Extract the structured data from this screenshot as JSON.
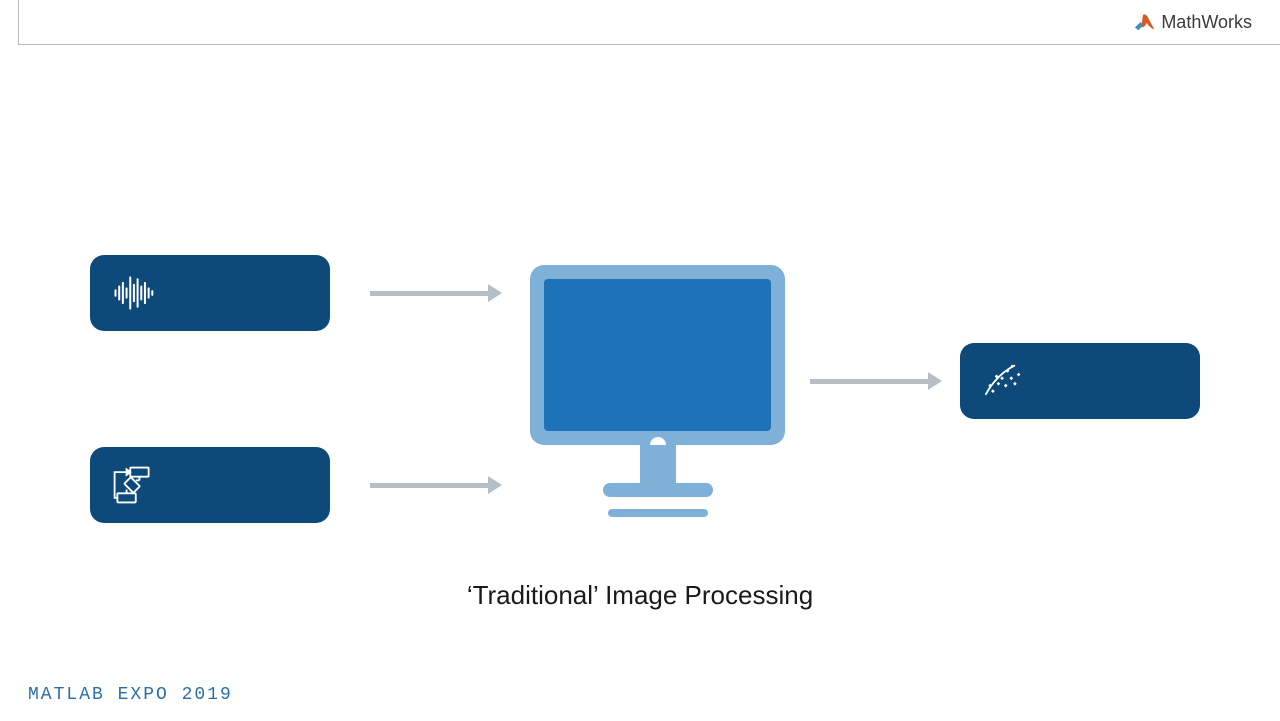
{
  "brand": {
    "name": "MathWorks",
    "logo_colors": {
      "left": "#3a8dd0",
      "right": "#d95b1f"
    }
  },
  "diagram": {
    "inputs": [
      {
        "icon": "waveform-icon"
      },
      {
        "icon": "flowchart-icon"
      }
    ],
    "center": {
      "icon": "computer-icon"
    },
    "output": {
      "icon": "scatter-plot-icon"
    },
    "caption": "‘Traditional’ Image Processing"
  },
  "footer": {
    "text": "MATLAB EXPO 2019"
  },
  "colors": {
    "box_bg": "#0d4a7a",
    "monitor_frame": "#7fb0d8",
    "monitor_screen": "#1e72b8",
    "arrow": "#b6bec6",
    "accent": "#2b6ea7"
  }
}
